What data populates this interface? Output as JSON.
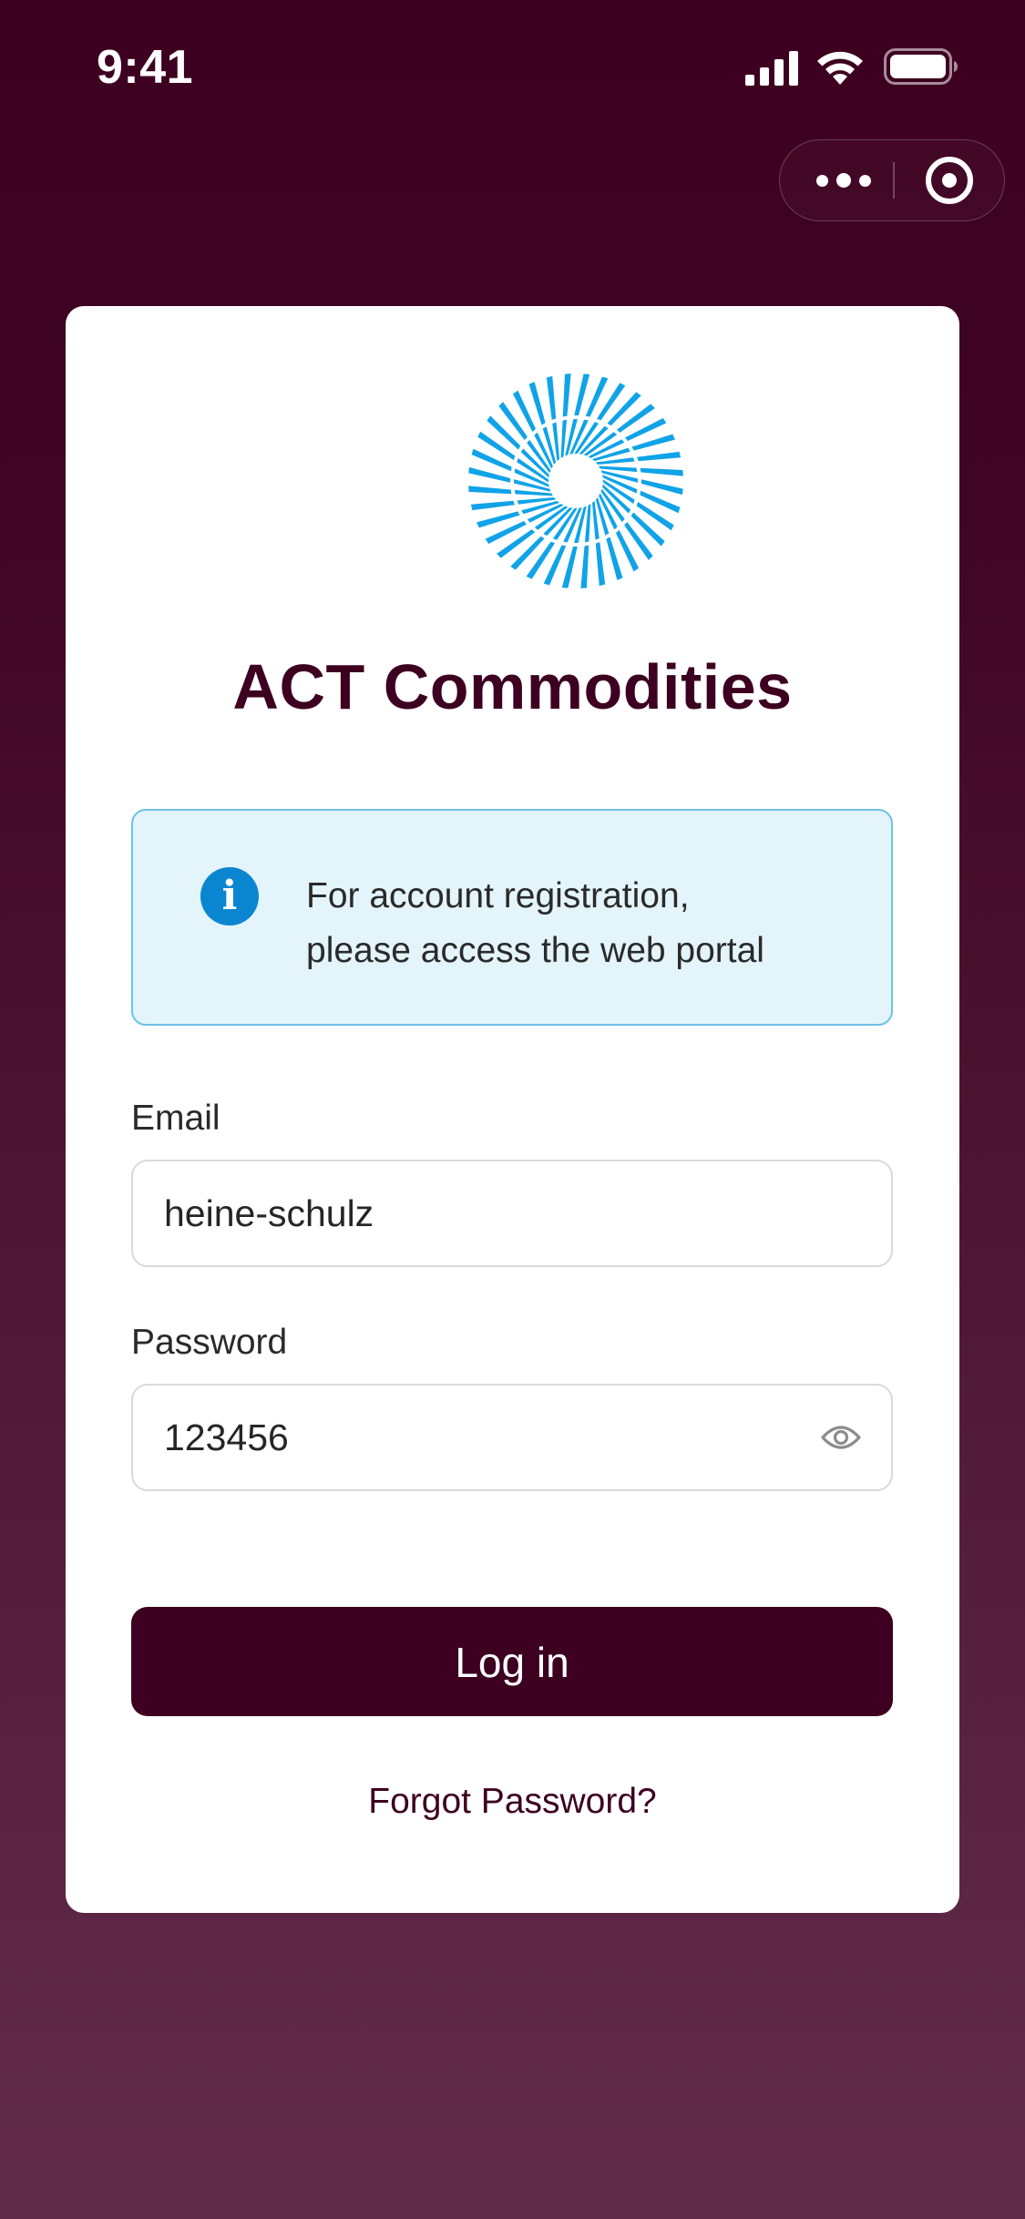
{
  "status_bar": {
    "time": "9:41"
  },
  "capsule": {
    "more_icon": "more-dots-icon",
    "close_icon": "target-circle-icon"
  },
  "brand": {
    "logo_icon": "radial-burst-logo",
    "title": "ACT Commodities",
    "logo_color": "#10a3e8"
  },
  "info": {
    "icon": "info-icon",
    "line1": "For account registration,",
    "line2": "please access the web portal"
  },
  "form": {
    "email_label": "Email",
    "email_value": "heine-schulz",
    "password_label": "Password",
    "password_value": "123456",
    "password_toggle_icon": "eye-icon",
    "login_label": "Log in",
    "forgot_label": "Forgot Password?"
  },
  "colors": {
    "brand_dark": "#3d0020",
    "info_bg": "#e3f4fb",
    "info_border": "#6fc1e6",
    "info_icon": "#0a86d0"
  }
}
